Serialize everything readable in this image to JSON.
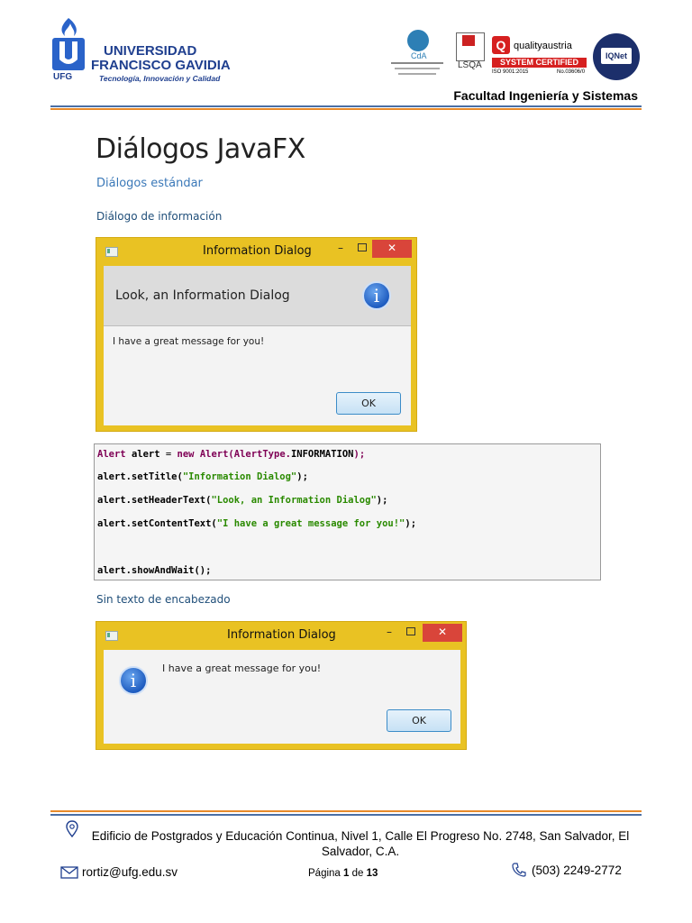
{
  "header": {
    "university_line1": "UNIVERSIDAD",
    "university_line2": "FRANCISCO GAVIDIA",
    "tagline": "Tecnología, Innovación y Calidad",
    "logo_text": "UFG",
    "cda_label": "CdA",
    "lsqa_label": "LSQA",
    "qa_brand": "qualityaustria",
    "qa_system": "SYSTEM CERTIFIED",
    "qa_iso": "ISO 9001:2015",
    "qa_no": "No.03606/0",
    "iqnet_label": "IQNet",
    "faculty": "Facultad Ingeniería y Sistemas"
  },
  "doc": {
    "title": "Diálogos JavaFX",
    "section": "Diálogos estándar",
    "subsection1": "Diálogo de información",
    "subsection2": "Sin texto de encabezado"
  },
  "dialog1": {
    "window_title": "Information Dialog",
    "header_text": "Look, an Information Dialog",
    "content_text": "I have a great message for you!",
    "ok_label": "OK",
    "min_glyph": "–",
    "close_glyph": "✕",
    "info_glyph": "i"
  },
  "dialog2": {
    "window_title": "Information Dialog",
    "content_text": "I have a great message for you!",
    "ok_label": "OK",
    "min_glyph": "–",
    "close_glyph": "✕",
    "info_glyph": "i"
  },
  "code": {
    "l1": {
      "a": "Alert ",
      "b": "alert",
      " c": " = ",
      "d": "new ",
      "e": "Alert",
      "f": "(AlertType.",
      "g": "INFORMATION",
      "h": ");"
    },
    "l2": {
      "a": "alert",
      "b": ".setTitle(",
      "c": "\"Information Dialog\"",
      "d": ");"
    },
    "l3": {
      "a": "alert",
      "b": ".setHeaderText(",
      "c": "\"Look, an Information Dialog\"",
      "d": ");"
    },
    "l4": {
      "a": "alert",
      "b": ".setContentText(",
      "c": "\"I have a great message for you!\"",
      "d": ");"
    },
    "l5": {
      "a": "alert",
      "b": ".showAndWait();"
    }
  },
  "footer": {
    "address": "Edificio de Postgrados y Educación Continua, Nivel 1, Calle El Progreso No. 2748, San Salvador, El Salvador, C.A.",
    "email": "rortiz@ufg.edu.sv",
    "page_prefix": "Página ",
    "page_current": "1",
    "page_mid": " de ",
    "page_total": "13",
    "phone": "(503) 2249-2772"
  }
}
